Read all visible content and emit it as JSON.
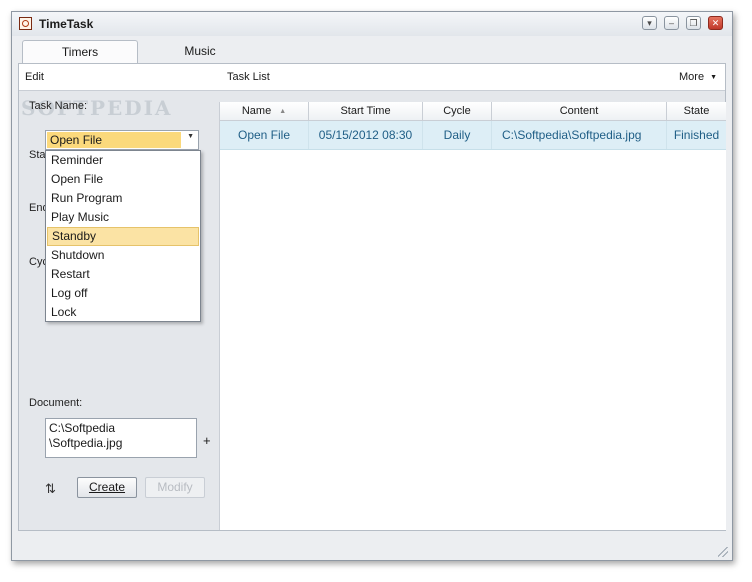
{
  "window": {
    "title": "TimeTask",
    "controls": [
      "dropdown-arrow",
      "minimize",
      "restore",
      "close"
    ]
  },
  "tabs": [
    {
      "label": "Timers",
      "active": true
    },
    {
      "label": "Music",
      "active": false
    }
  ],
  "menubar": {
    "edit": "Edit",
    "task_list": "Task List",
    "more": "More"
  },
  "form": {
    "task_name_label": "Task Name:",
    "task_name_value": "Open File",
    "start_label": "Sta",
    "end_label": "End",
    "cycle_label": "Cyc",
    "document_label": "Document:",
    "document_value_line1": "C:\\Softpedia",
    "document_value_line2": "\\Softpedia.jpg",
    "add_label": "+",
    "create_label": "Create",
    "modify_label": "Modify"
  },
  "dropdown": {
    "options": [
      "Reminder",
      "Open File",
      "Run Program",
      "Play Music",
      "Standby",
      "Shutdown",
      "Restart",
      "Log off",
      "Lock"
    ],
    "highlighted": "Standby"
  },
  "watermark": "SOFTPEDIA",
  "table": {
    "columns": [
      "Name",
      "Start Time",
      "Cycle",
      "Content",
      "State"
    ],
    "sort_column": "Name",
    "rows": [
      {
        "name": "Open File",
        "start_time": "05/15/2012 08:30",
        "cycle": "Daily",
        "content": "C:\\Softpedia\\Softpedia.jpg",
        "state": "Finished"
      }
    ]
  },
  "colors": {
    "selection": "#fbd97c",
    "row_highlight": "#ddeef6",
    "row_text": "#1f5e86",
    "close_button": "#c0392b"
  }
}
